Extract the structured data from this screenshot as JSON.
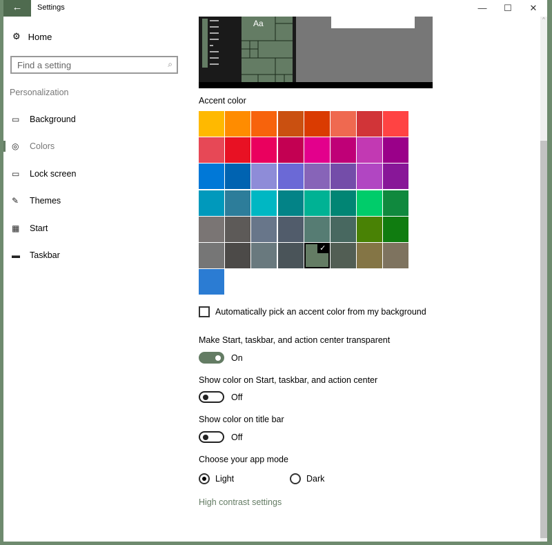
{
  "window": {
    "title": "Settings",
    "back_icon": "arrow-left-icon",
    "minimize": "—",
    "maximize": "☐",
    "close": "✕"
  },
  "sidebar": {
    "home": "Home",
    "search_placeholder": "Find a setting",
    "section": "Personalization",
    "items": [
      {
        "label": "Background",
        "icon": "image-icon",
        "glyph": "▭"
      },
      {
        "label": "Colors",
        "icon": "palette-icon",
        "glyph": "◎",
        "selected": true
      },
      {
        "label": "Lock screen",
        "icon": "lock-screen-icon",
        "glyph": "▭"
      },
      {
        "label": "Themes",
        "icon": "themes-icon",
        "glyph": "✎"
      },
      {
        "label": "Start",
        "icon": "start-icon",
        "glyph": "▦"
      },
      {
        "label": "Taskbar",
        "icon": "taskbar-icon",
        "glyph": "▬"
      }
    ]
  },
  "main": {
    "preview_text": "Aa",
    "accent_label": "Accent color",
    "accent_colors": [
      "#FFB900",
      "#FF8C00",
      "#F7630C",
      "#CA5010",
      "#DA3B01",
      "#EF6950",
      "#D13438",
      "#FF4343",
      "#E74856",
      "#E81123",
      "#EA005E",
      "#C30052",
      "#E3008C",
      "#BF0077",
      "#C239B3",
      "#9A0089",
      "#0078D7",
      "#0063B1",
      "#8E8CD8",
      "#6B69D6",
      "#8764B8",
      "#744DA9",
      "#B146C2",
      "#881798",
      "#0099BC",
      "#2D7D9A",
      "#00B7C3",
      "#038387",
      "#00B294",
      "#018574",
      "#00CC6A",
      "#10893E",
      "#7A7574",
      "#5D5A58",
      "#68768A",
      "#515C6B",
      "#567C73",
      "#486860",
      "#498205",
      "#107C10",
      "#767676",
      "#4C4A48",
      "#69797E",
      "#4A5459",
      "#647C64",
      "#525E54",
      "#847545",
      "#7E735F",
      "#2B7CD3"
    ],
    "selected_accent": "#647C64",
    "auto_pick": {
      "label": "Automatically pick an accent color from my background",
      "checked": false
    },
    "transparent": {
      "label": "Make Start, taskbar, and action center transparent",
      "state": "On",
      "on": true
    },
    "show_start": {
      "label": "Show color on Start, taskbar, and action center",
      "state": "Off",
      "on": false
    },
    "show_title": {
      "label": "Show color on title bar",
      "state": "Off",
      "on": false
    },
    "app_mode": {
      "label": "Choose your app mode",
      "light": "Light",
      "dark": "Dark",
      "selected": "Light"
    },
    "high_contrast": "High contrast settings"
  }
}
